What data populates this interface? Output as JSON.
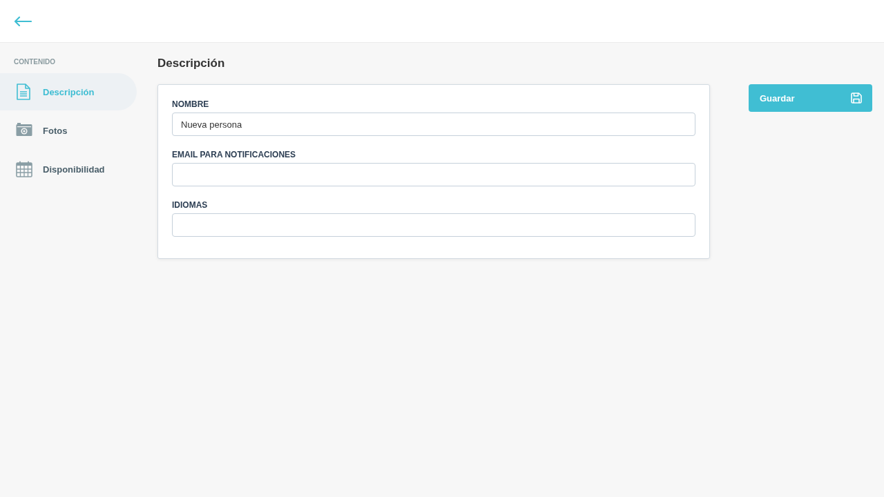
{
  "sidebar": {
    "heading": "CONTENIDO",
    "items": [
      {
        "label": "Descripción",
        "kind": "document",
        "selected": true
      },
      {
        "label": "Fotos",
        "kind": "camera",
        "selected": false
      },
      {
        "label": "Disponibilidad",
        "kind": "calendar",
        "selected": false
      }
    ]
  },
  "page_title": "Descripción",
  "form": {
    "fields": [
      {
        "label": "NOMBRE",
        "value": "Nueva persona"
      },
      {
        "label": "EMAIL PARA NOTIFICACIONES"
      },
      {
        "label": "IDIOMAS"
      }
    ]
  },
  "save_button": {
    "label": "Guardar"
  }
}
